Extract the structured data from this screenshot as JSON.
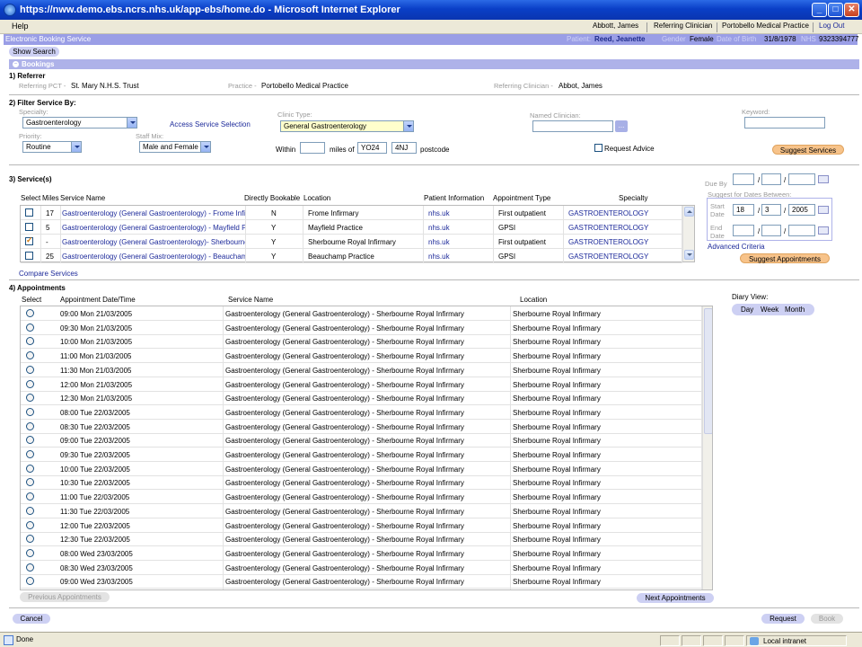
{
  "window": {
    "title": "https://nww.demo.ebs.ncrs.nhs.uk/app-ebs/home.do - Microsoft Internet Explorer"
  },
  "menu": {
    "help": "Help",
    "user": "Abbott, James",
    "role": "Referring Clinician",
    "practice": "Portobello Medical Practice",
    "logout": "Log Out"
  },
  "appbar": {
    "title": "Electronic Booking Service",
    "patient_label": "Patient:",
    "patient": "Reed, Jeanette",
    "gender_label": "Gender",
    "gender": "Female",
    "dob_label": "Date of Birth",
    "dob": "31/8/1978",
    "nhs_label": "NHS",
    "nhs": "9323394777"
  },
  "show_search": "Show Search",
  "bookings_title": "Bookings",
  "referrer": {
    "title": "1) Referrer",
    "pct_label": "Referring PCT -",
    "pct": "St. Mary N.H.S. Trust",
    "practice_label": "Practice -",
    "practice": "Portobello Medical Practice",
    "clinician_label": "Referring Clinician -",
    "clinician": "Abbot, James"
  },
  "filter": {
    "title": "2) Filter Service By:",
    "specialty_label": "Specialty:",
    "specialty": "Gastroenterology",
    "access_link": "Access Service Selection",
    "clinic_label": "Clinic Type:",
    "clinic": "General Gastroenterology",
    "named_label": "Named Clinician:",
    "named_btn": "...",
    "keyword_label": "Keyword:",
    "priority_label": "Priority:",
    "priority": "Routine",
    "staff_label": "Staff Mix:",
    "staff": "Male and Female",
    "within": "Within",
    "miles_of": "miles of",
    "pc1": "YO24",
    "pc2": "4NJ",
    "postcode": "postcode",
    "request_advice": "Request Advice",
    "suggest_services": "Suggest Services"
  },
  "services": {
    "title": "3) Service(s)",
    "headers": [
      "Select",
      "Miles",
      "Service Name",
      "Directly Bookable",
      "Location",
      "Patient Information",
      "Appointment Type",
      "Specialty"
    ],
    "rows": [
      {
        "miles": "17",
        "name": "Gastroenterology (General Gastroenterology) - Frome Infirmary",
        "bookable": "N",
        "location": "Frome Infirmary",
        "info": "nhs.uk",
        "type": "First outpatient",
        "specialty": "GASTROENTEROLOGY",
        "checked": false
      },
      {
        "miles": "5",
        "name": "Gastroenterology (General Gastroenterology) - Mayfield Practice",
        "bookable": "Y",
        "location": "Mayfield Practice",
        "info": "nhs.uk",
        "type": "GPSI",
        "specialty": "GASTROENTEROLOGY",
        "checked": false
      },
      {
        "miles": "-",
        "name": "Gastroenterology (General Gastroenterology)- Sherbourne Royal Infirmary",
        "bookable": "Y",
        "location": "Sherbourne Royal Infirmary",
        "info": "nhs.uk",
        "type": "First outpatient",
        "specialty": "GASTROENTEROLOGY",
        "checked": true
      },
      {
        "miles": "25",
        "name": "Gastroenterology (General Gastroenterology) - Beauchamp Practice",
        "bookable": "Y",
        "location": "Beauchamp Practice",
        "info": "nhs.uk",
        "type": "GPSI",
        "specialty": "GASTROENTEROLOGY",
        "checked": false
      }
    ],
    "compare": "Compare Services",
    "due_by": "Due By",
    "sep": "/",
    "suggest_dates": "Suggest for Dates Between:",
    "start": "Start",
    "date": "Date",
    "end": "End",
    "start_d": "18",
    "start_m": "3",
    "start_y": "2005",
    "advanced": "Advanced Criteria",
    "suggest_appts": "Suggest Appointments"
  },
  "appointments": {
    "title": "4) Appointments",
    "headers": [
      "Select",
      "Appointment Date/Time",
      "Service Name",
      "Location"
    ],
    "service": "Gastroenterology (General Gastroenterology) - Sherbourne Royal Infirmary",
    "location": "Sherbourne Royal Infirmary",
    "times": [
      "09:00 Mon 21/03/2005",
      "09:30 Mon 21/03/2005",
      "10:00 Mon 21/03/2005",
      "11:00 Mon 21/03/2005",
      "11:30 Mon 21/03/2005",
      "12:00 Mon 21/03/2005",
      "12:30 Mon 21/03/2005",
      "08:00 Tue 22/03/2005",
      "08:30 Tue 22/03/2005",
      "09:00 Tue 22/03/2005",
      "09:30 Tue 22/03/2005",
      "10:00 Tue 22/03/2005",
      "10:30 Tue 22/03/2005",
      "11:00 Tue 22/03/2005",
      "11:30 Tue 22/03/2005",
      "12:00 Tue 22/03/2005",
      "12:30 Tue 22/03/2005",
      "08:00 Wed 23/03/2005",
      "08:30 Wed 23/03/2005",
      "09:00 Wed 23/03/2005"
    ],
    "diary_view": "Diary View:",
    "day": "Day",
    "week": "Week",
    "month": "Month",
    "prev": "Previous Appointments",
    "next": "Next Appointments"
  },
  "footer": {
    "cancel": "Cancel",
    "request": "Request",
    "book": "Book"
  },
  "status": {
    "done": "Done",
    "zone": "Local intranet"
  }
}
